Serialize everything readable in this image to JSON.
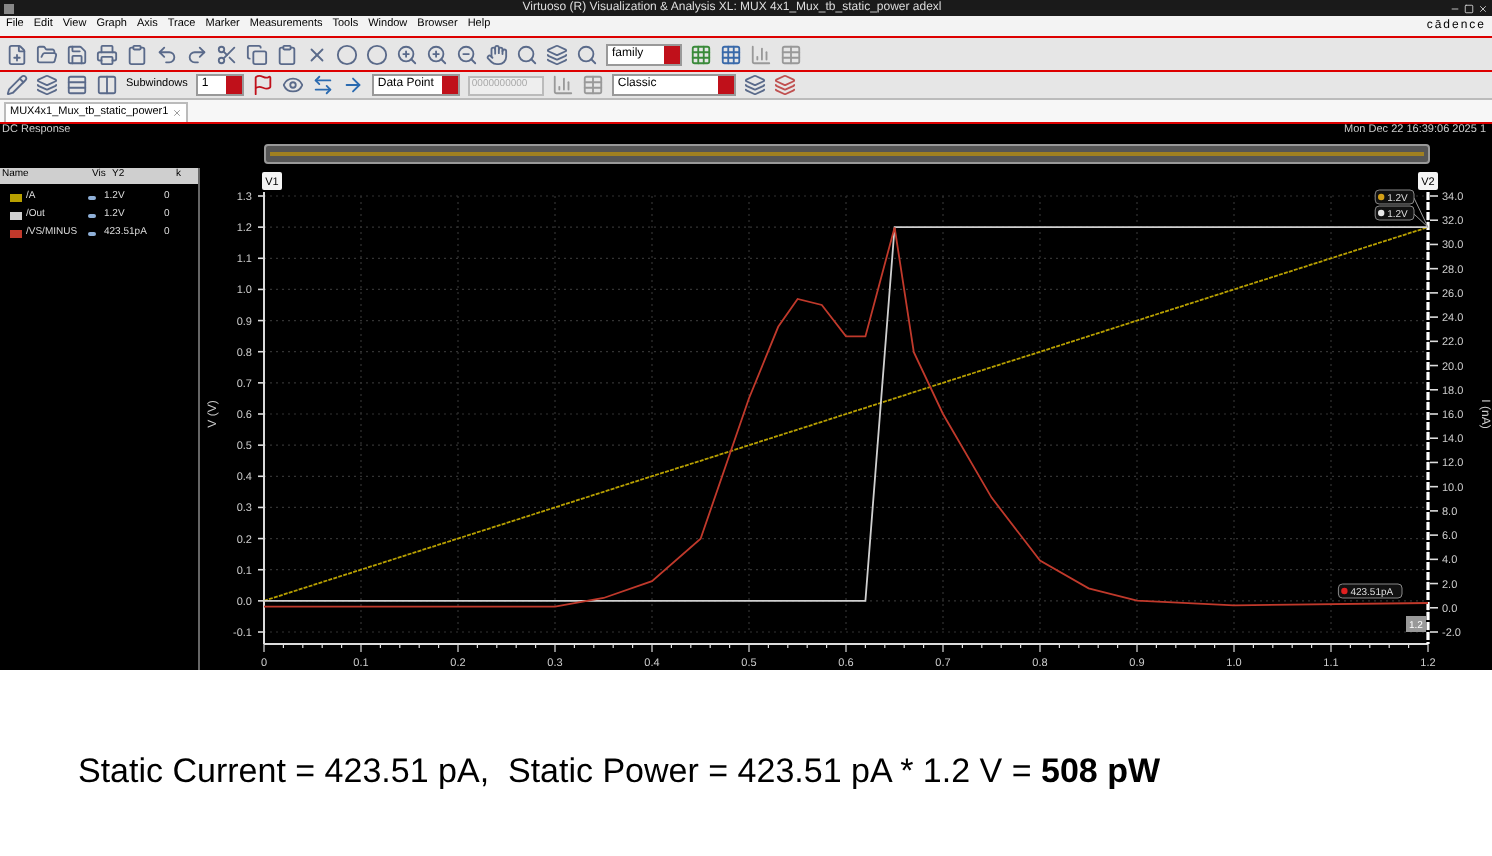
{
  "window": {
    "title": "Virtuoso (R) Visualization & Analysis XL: MUX 4x1_Mux_tb_static_power adexl",
    "brand": "cādence"
  },
  "menu": [
    "File",
    "Edit",
    "View",
    "Graph",
    "Axis",
    "Trace",
    "Marker",
    "Measurements",
    "Tools",
    "Window",
    "Browser",
    "Help"
  ],
  "toolbar": {
    "family_select": "family",
    "subwindows_label": "Subwindows",
    "subwindows_value": "1",
    "marker_mode": "Data Point",
    "marker_value": "0000000000",
    "style_select": "Classic"
  },
  "tabs": [
    {
      "label": "MUX4x1_Mux_tb_static_power1",
      "selected": true
    }
  ],
  "plot_window": {
    "name": "DC Response",
    "timestamp": "Mon Dec 22 16:39:06 2025",
    "page": "1"
  },
  "legend": {
    "columns": [
      "Name",
      "Vis",
      "Y2",
      "k"
    ],
    "traces": [
      {
        "visible": true,
        "value": "1.2V",
        "k": "0"
      },
      {
        "visible": true,
        "value": "1.2V",
        "k": "0"
      },
      {
        "visible": true,
        "value": "423.51pA",
        "k": "0"
      }
    ]
  },
  "markers": {
    "v1": "V1",
    "v2": "V2",
    "labels": [
      {
        "text": "1.2V",
        "color": "#d4a017"
      },
      {
        "text": "1.2V",
        "color": "#e8e8e8"
      },
      {
        "text": "423.51pA",
        "color": "#e02020"
      }
    ],
    "corner": "1.2"
  },
  "chart_data": {
    "type": "line",
    "grid": true,
    "ylabel": "V (V)",
    "y2label": "I (nA)",
    "xlim": [
      0,
      1.2
    ],
    "ylim": [
      -0.1,
      1.3
    ],
    "y2lim": [
      -2,
      34
    ],
    "xticks": [
      0,
      {
        "value": 0.1,
        "label": "0.1"
      },
      {
        "value": 0.2,
        "label": "0.2"
      },
      {
        "value": 0.3,
        "label": "0.3"
      },
      {
        "value": 0.4,
        "label": "0.4"
      },
      {
        "value": 0.5,
        "label": "0.5"
      },
      {
        "value": 0.6,
        "label": "0.6"
      },
      {
        "value": 0.7,
        "label": "0.7"
      },
      {
        "value": 0.8,
        "label": "0.8"
      },
      {
        "value": 0.9,
        "label": "0.9"
      },
      {
        "value": 1.0,
        "label": "1.0"
      },
      {
        "value": 1.1,
        "label": "1.1"
      },
      {
        "value": 1.2,
        "label": "1.2"
      }
    ],
    "yticks": [
      {
        "value": -0.1,
        "label": "-0.1"
      },
      {
        "value": 0,
        "label": "0.0"
      },
      {
        "value": 0.1,
        "label": "0.1"
      },
      {
        "value": 0.2,
        "label": "0.2"
      },
      {
        "value": 0.3,
        "label": "0.3"
      },
      {
        "value": 0.4,
        "label": "0.4"
      },
      {
        "value": 0.5,
        "label": "0.5"
      },
      {
        "value": 0.6,
        "label": "0.6"
      },
      {
        "value": 0.7,
        "label": "0.7"
      },
      {
        "value": 0.8,
        "label": "0.8"
      },
      {
        "value": 0.9,
        "label": "0.9"
      },
      {
        "value": 1.0,
        "label": "1.0"
      },
      {
        "value": 1.1,
        "label": "1.1"
      },
      {
        "value": 1.2,
        "label": "1.2"
      },
      {
        "value": 1.3,
        "label": "1.3"
      }
    ],
    "y2ticks": [
      {
        "value": -2,
        "label": "-2.0"
      },
      {
        "value": 0,
        "label": "0.0"
      },
      {
        "value": 2,
        "label": "2.0"
      },
      {
        "value": 4,
        "label": "4.0"
      },
      {
        "value": 6,
        "label": "6.0"
      },
      {
        "value": 8,
        "label": "8.0"
      },
      {
        "value": 10,
        "label": "10.0"
      },
      {
        "value": 12,
        "label": "12.0"
      },
      {
        "value": 14,
        "label": "14.0"
      },
      {
        "value": 16,
        "label": "16.0"
      },
      {
        "value": 18,
        "label": "18.0"
      },
      {
        "value": 20,
        "label": "20.0"
      },
      {
        "value": 22,
        "label": "22.0"
      },
      {
        "value": 24,
        "label": "24.0"
      },
      {
        "value": 26,
        "label": "26.0"
      },
      {
        "value": 28,
        "label": "28.0"
      },
      {
        "value": 30,
        "label": "30.0"
      },
      {
        "value": 32,
        "label": "32.0"
      },
      {
        "value": 34,
        "label": "34.0"
      }
    ],
    "x": [
      0,
      0.3,
      0.35,
      0.4,
      0.45,
      0.5,
      0.53,
      0.55,
      0.575,
      0.6,
      0.62,
      0.65,
      0.67,
      0.7,
      0.75,
      0.8,
      0.85,
      0.9,
      1.0,
      1.2
    ],
    "series": [
      {
        "name": "/A",
        "color": "#b8a000",
        "axis": "y",
        "line_style": "dashed",
        "values": [
          0,
          0.3,
          0.35,
          0.4,
          0.45,
          0.5,
          0.53,
          0.55,
          0.575,
          0.6,
          0.62,
          0.65,
          0.67,
          0.7,
          0.75,
          0.8,
          0.85,
          0.9,
          1.0,
          1.2
        ]
      },
      {
        "name": "/Out",
        "color": "#d0d0d0",
        "axis": "y",
        "line_style": "solid",
        "values": [
          0,
          0,
          0,
          0,
          0,
          0,
          0,
          0,
          0,
          0,
          0,
          1.2,
          1.2,
          1.2,
          1.2,
          1.2,
          1.2,
          1.2,
          1.2,
          1.2
        ]
      },
      {
        "name": "/VS/MINUS",
        "color": "#c0392b",
        "axis": "y2",
        "line_style": "solid",
        "values": [
          0.1,
          0.1,
          0.8,
          2.2,
          5.7,
          17.3,
          23.2,
          25.5,
          25.0,
          22.4,
          22.4,
          31.4,
          21.1,
          16.0,
          9.1,
          3.9,
          1.6,
          0.6,
          0.2,
          0.4
        ]
      }
    ]
  },
  "caption": "Static Current = 423.51 pA,  Static Power = 423.51 pA * 1.2 V = **508 pW**"
}
